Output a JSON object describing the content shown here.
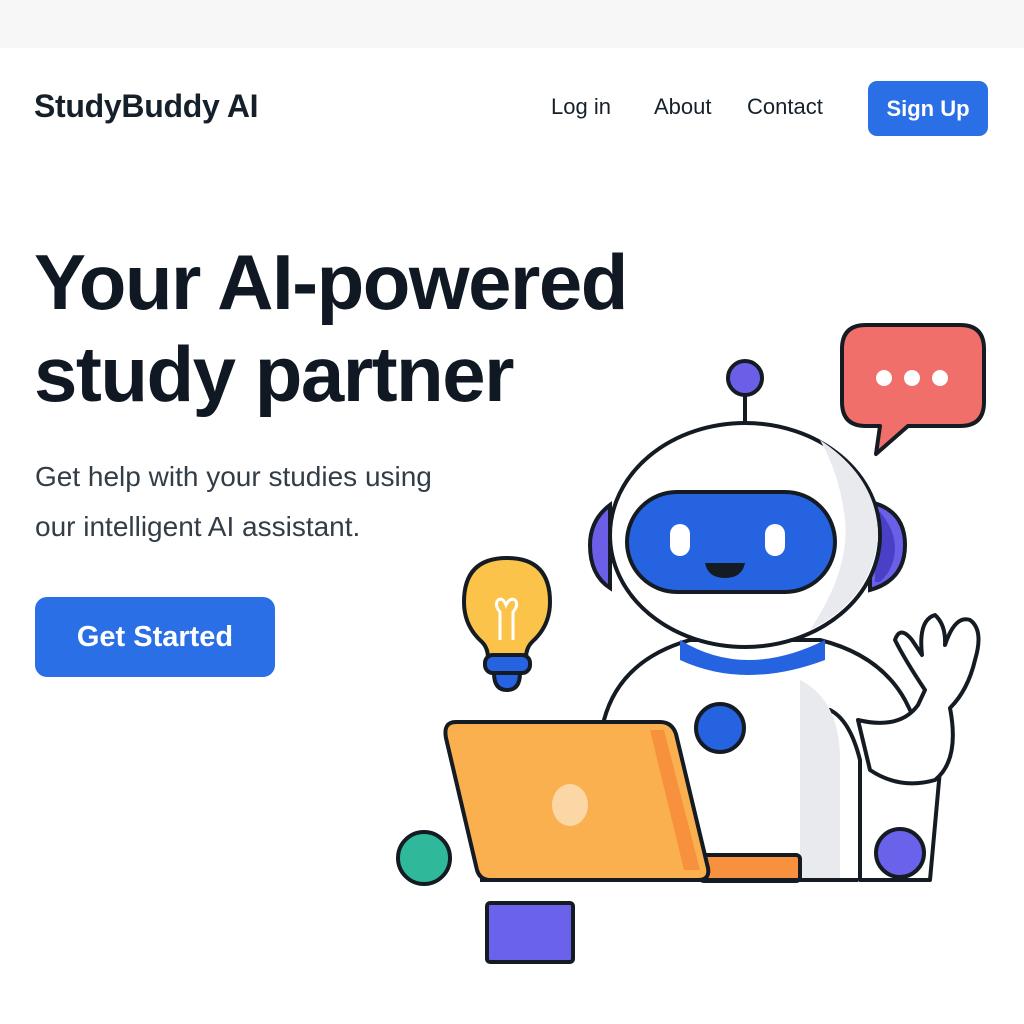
{
  "header": {
    "brand": "StudyBuddy AI",
    "nav": {
      "login": "Log in",
      "about": "About",
      "contact": "Contact",
      "signup": "Sign Up"
    }
  },
  "hero": {
    "title_line1": "Your AI-powered",
    "title_line2": "study partner",
    "subtitle_line1": "Get help with your studies using",
    "subtitle_line2": "our intelligent AI assistant.",
    "cta": "Get Started"
  },
  "illustration": {
    "icons": [
      "robot-mascot-icon",
      "chat-bubble-icon",
      "lightbulb-icon",
      "laptop-icon",
      "decorative-circle-icon",
      "decorative-square-icon"
    ]
  },
  "colors": {
    "primary": "#2b6fe6",
    "robot_accent": "#2563e0",
    "headphone": "#6b5fe8",
    "chat_bubble": "#f06f6a",
    "laptop": "#fbb04f",
    "bulb": "#fcc34a",
    "teal": "#2fb89a",
    "violet": "#6a62ea"
  }
}
